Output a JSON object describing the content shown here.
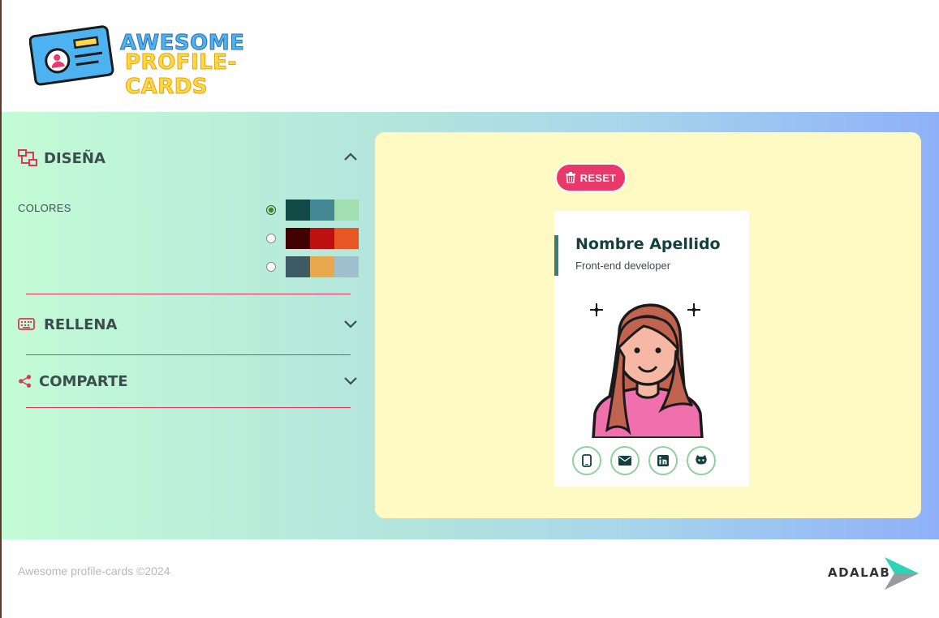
{
  "header": {
    "logo_line1": "AWESOME",
    "logo_line2": "PROFILE-CARDS"
  },
  "sections": {
    "design": {
      "title": "DISEÑA",
      "icon": "layout-icon",
      "expanded": true
    },
    "fill": {
      "title": "RELLENA",
      "icon": "keyboard-icon",
      "expanded": false
    },
    "share": {
      "title": "COMPARTE",
      "icon": "share-icon",
      "expanded": false
    }
  },
  "colors": {
    "label": "COLORES",
    "palettes": [
      {
        "selected": true,
        "swatches": [
          "#114946",
          "#438792",
          "#a2deaf"
        ]
      },
      {
        "selected": false,
        "swatches": [
          "#420101",
          "#bd1010",
          "#e95626"
        ]
      },
      {
        "selected": false,
        "swatches": [
          "#3e5b65",
          "#eaa84c",
          "#a0c0cf"
        ]
      }
    ]
  },
  "preview": {
    "reset_label": "RESET",
    "card": {
      "name": "Nombre Apellido",
      "job": "Front-end developer",
      "socials": [
        "phone-icon",
        "email-icon",
        "linkedin-icon",
        "github-icon"
      ]
    }
  },
  "footer": {
    "copyright": "Awesome profile-cards ©2024",
    "brand": "ADALAB"
  },
  "theme": {
    "accent": "#e9386a",
    "card_title_color": "#14403e",
    "preview_bg": "#fffac4"
  }
}
